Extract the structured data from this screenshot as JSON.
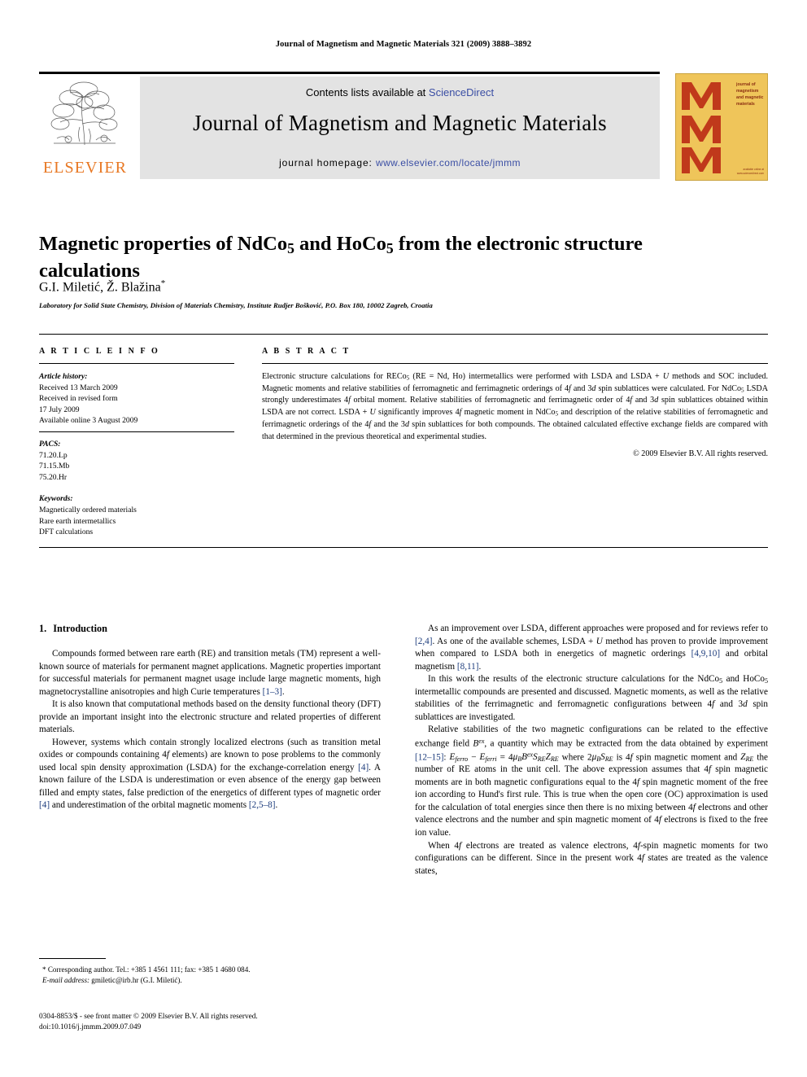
{
  "running_head": "Journal of Magnetism and Magnetic Materials 321 (2009) 3888–3892",
  "masthead": {
    "publisher_name": "ELSEVIER",
    "contents_prefix": "Contents lists available at ",
    "contents_link": "ScienceDirect",
    "journal_name": "Journal of Magnetism and Magnetic Materials",
    "homepage_prefix": "journal homepage: ",
    "homepage_url": "www.elsevier.com/locate/jmmm",
    "cover_caption": "journal of magnetism and magnetic materials",
    "cover_footer": "available online at www.sciencedirect.com",
    "link_color": "#3a4ea4",
    "elsevier_orange": "#E87722",
    "cover_background": "#efc55a",
    "cover_letter_color": "#c0391b"
  },
  "article": {
    "title": "Magnetic properties of NdCo5 and HoCo5 from the electronic structure calculations",
    "authors": "G.I. Miletić, Ž. Blažina",
    "affiliation": "Laboratory for Solid State Chemistry, Division of Materials Chemistry, Institute Rudjer Bošković, P.O. Box 180, 10002 Zagreb, Croatia"
  },
  "article_info": {
    "heading": "A R T I C L E    I N F O",
    "history_label": "Article history:",
    "history": [
      "Received 13 March 2009",
      "Received in revised form",
      "17 July 2009",
      "Available online 3 August 2009"
    ],
    "pacs_label": "PACS:",
    "pacs": [
      "71.20.Lp",
      "71.15.Mb",
      "75.20.Hr"
    ],
    "keywords_label": "Keywords:",
    "keywords": [
      "Magnetically ordered materials",
      "Rare earth intermetallics",
      "DFT calculations"
    ]
  },
  "abstract": {
    "heading": "A B S T R A C T",
    "text": "Electronic structure calculations for RECo5 (RE = Nd, Ho) intermetallics were performed with LSDA and LSDA + U methods and SOC included. Magnetic moments and relative stabilities of ferromagnetic and ferrimagnetic orderings of 4f and 3d spin sublattices were calculated. For NdCo5 LSDA strongly underestimates 4f orbital moment. Relative stabilities of ferromagnetic and ferrimagnetic order of 4f and 3d spin sublattices obtained within LSDA are not correct. LSDA + U significantly improves 4f magnetic moment in NdCo5 and description of the relative stabilities of ferromagnetic and ferrimagnetic orderings of the 4f and the 3d spin sublattices for both compounds. The obtained calculated effective exchange fields are compared with that determined in the previous theoretical and experimental studies.",
    "copyright": "© 2009 Elsevier B.V. All rights reserved."
  },
  "body": {
    "section_number": "1.",
    "section_title": "Introduction",
    "left_paragraphs": [
      "Compounds formed between rare earth (RE) and transition metals (TM) represent a well-known source of materials for permanent magnet applications. Magnetic properties important for successful materials for permanent magnet usage include large magnetic moments, high magnetocrystalline anisotropies and high Curie temperatures [1–3].",
      "It is also known that computational methods based on the density functional theory (DFT) provide an important insight into the electronic structure and related properties of different materials.",
      "However, systems which contain strongly localized electrons (such as transition metal oxides or compounds containing 4f elements) are known to pose problems to the commonly used local spin density approximation (LSDA) for the exchange-correlation energy [4]. A known failure of the LSDA is underestimation or even absence of the energy gap between filled and empty states, false prediction of the energetics of different types of magnetic order [4] and underestimation of the orbital magnetic moments [2,5–8]."
    ],
    "right_paragraphs": [
      "As an improvement over LSDA, different approaches were proposed and for reviews refer to [2,4]. As one of the available schemes, LSDA + U method has proven to provide improvement when compared to LSDA both in energetics of magnetic orderings [4,9,10] and orbital magnetism [8,11].",
      "In this work the results of the electronic structure calculations for the NdCo5 and HoCo5 intermetallic compounds are presented and discussed. Magnetic moments, as well as the relative stabilities of the ferrimagnetic and ferromagnetic configurations between 4f and 3d spin sublattices are investigated.",
      "Relative stabilities of the two magnetic configurations can be related to the effective exchange field Bex, a quantity which may be extracted from the data obtained by experiment [12–15]: Eferro − Eferri = 4μBBexSREZRE where 2μBSRE is 4f spin magnetic moment and ZRE the number of RE atoms in the unit cell. The above expression assumes that 4f spin magnetic moments are in both magnetic configurations equal to the 4f spin magnetic moment of the free ion according to Hund's first rule. This is true when the open core (OC) approximation is used for the calculation of total energies since then there is no mixing between 4f electrons and other valence electrons and the number and spin magnetic moment of 4f electrons is fixed to the free ion value.",
      "When 4f electrons are treated as valence electrons, 4f-spin magnetic moments for two configurations can be different. Since in the present work 4f states are treated as the valence states,"
    ]
  },
  "footnotes": {
    "corresponding": "* Corresponding author. Tel.: +385 1 4561 111; fax: +385 1 4680 084.",
    "email_label": "E-mail address:",
    "email": "gmiletic@irb.hr (G.I. Miletić).",
    "imprint_line1": "0304-8853/$ - see front matter © 2009 Elsevier B.V. All rights reserved.",
    "imprint_line2": "doi:10.1016/j.jmmm.2009.07.049"
  }
}
